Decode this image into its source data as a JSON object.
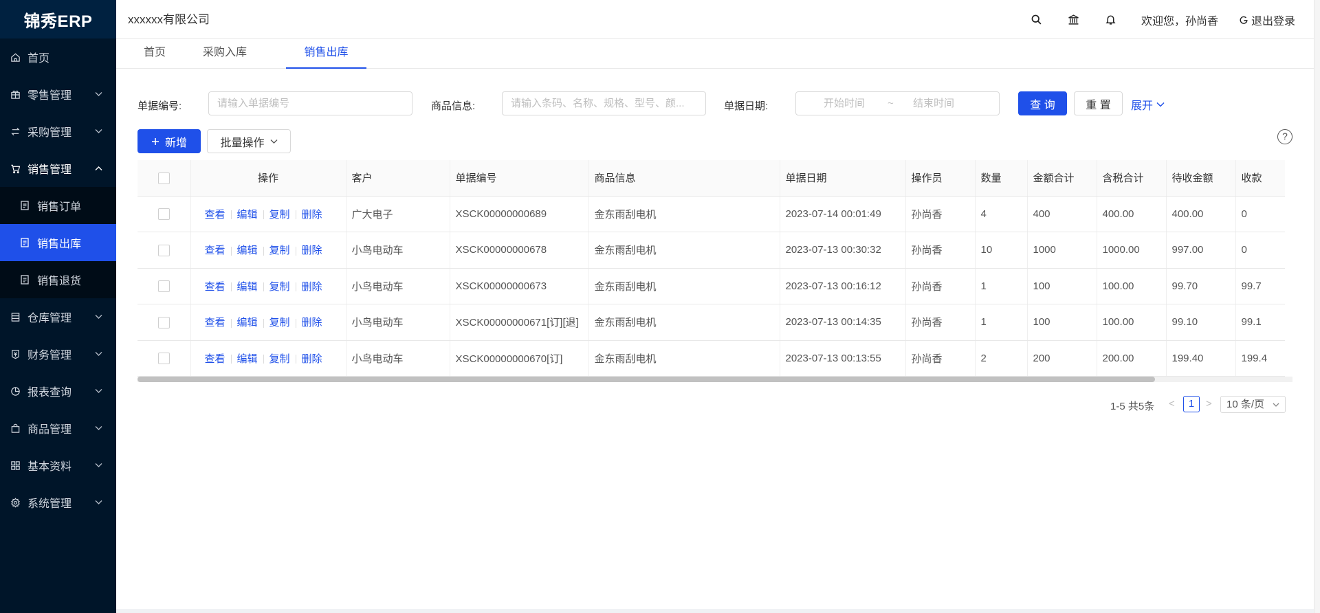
{
  "app": {
    "logo": "锦秀ERP"
  },
  "header": {
    "company": "xxxxxx有限公司",
    "welcome": "欢迎您，孙尚香",
    "logout": "退出登录",
    "icons": [
      "search-icon",
      "bank-icon",
      "bell-icon"
    ]
  },
  "sidebar": {
    "items": [
      {
        "label": "首页",
        "icon": "home-icon"
      },
      {
        "label": "零售管理",
        "icon": "gift-icon"
      },
      {
        "label": "采购管理",
        "icon": "swap-icon"
      },
      {
        "label": "销售管理",
        "icon": "cart-icon"
      },
      {
        "label": "仓库管理",
        "icon": "warehouse-icon"
      },
      {
        "label": "财务管理",
        "icon": "finance-icon"
      },
      {
        "label": "报表查询",
        "icon": "chart-pie-icon"
      },
      {
        "label": "商品管理",
        "icon": "shopping-bag-icon"
      },
      {
        "label": "基本资料",
        "icon": "apps-icon"
      },
      {
        "label": "系统管理",
        "icon": "setting-icon"
      }
    ],
    "sales_sub": [
      {
        "label": "销售订单"
      },
      {
        "label": "销售出库"
      },
      {
        "label": "销售退货"
      }
    ]
  },
  "tabs": [
    {
      "label": "首页"
    },
    {
      "label": "采购入库"
    },
    {
      "label": "销售出库"
    }
  ],
  "search": {
    "bill_no_label": "单据编号:",
    "bill_no_placeholder": "请输入单据编号",
    "goods_label": "商品信息:",
    "goods_placeholder": "请输入条码、名称、规格、型号、颜...",
    "date_label": "单据日期:",
    "date_start": "开始时间",
    "date_sep": "~",
    "date_end": "结束时间",
    "query": "查 询",
    "reset": "重 置",
    "expand": "展开"
  },
  "toolbar": {
    "add": "新增",
    "batch": "批量操作"
  },
  "table": {
    "columns": [
      "操作",
      "客户",
      "单据编号",
      "商品信息",
      "单据日期",
      "操作员",
      "数量",
      "金额合计",
      "含税合计",
      "待收金额",
      "收款"
    ],
    "actions": [
      "查看",
      "编辑",
      "复制",
      "删除"
    ],
    "rows": [
      {
        "customer": "广大电子",
        "bill_no": "XSCK00000000689",
        "goods": "金东雨刮电机",
        "date": "2023-07-14 00:01:49",
        "operator": "孙尚香",
        "qty": "4",
        "amount": "400",
        "tax_total": "400.00",
        "pending": "400.00",
        "received": "0"
      },
      {
        "customer": "小鸟电动车",
        "bill_no": "XSCK00000000678",
        "goods": "金东雨刮电机",
        "date": "2023-07-13 00:30:32",
        "operator": "孙尚香",
        "qty": "10",
        "amount": "1000",
        "tax_total": "1000.00",
        "pending": "997.00",
        "received": "0"
      },
      {
        "customer": "小鸟电动车",
        "bill_no": "XSCK00000000673",
        "goods": "金东雨刮电机",
        "date": "2023-07-13 00:16:12",
        "operator": "孙尚香",
        "qty": "1",
        "amount": "100",
        "tax_total": "100.00",
        "pending": "99.70",
        "received": "99.7"
      },
      {
        "customer": "小鸟电动车",
        "bill_no": "XSCK00000000671[订][退]",
        "goods": "金东雨刮电机",
        "date": "2023-07-13 00:14:35",
        "operator": "孙尚香",
        "qty": "1",
        "amount": "100",
        "tax_total": "100.00",
        "pending": "99.10",
        "received": "99.1"
      },
      {
        "customer": "小鸟电动车",
        "bill_no": "XSCK00000000670[订]",
        "goods": "金东雨刮电机",
        "date": "2023-07-13 00:13:55",
        "operator": "孙尚香",
        "qty": "2",
        "amount": "200",
        "tax_total": "200.00",
        "pending": "199.40",
        "received": "199.4"
      }
    ]
  },
  "pagination": {
    "total": "1-5 共5条",
    "prev": "<",
    "current": "1",
    "next": ">",
    "page_size": "10 条/页"
  },
  "colors": {
    "primary": "#1f50e9",
    "sidebar_bg": "#001529"
  }
}
